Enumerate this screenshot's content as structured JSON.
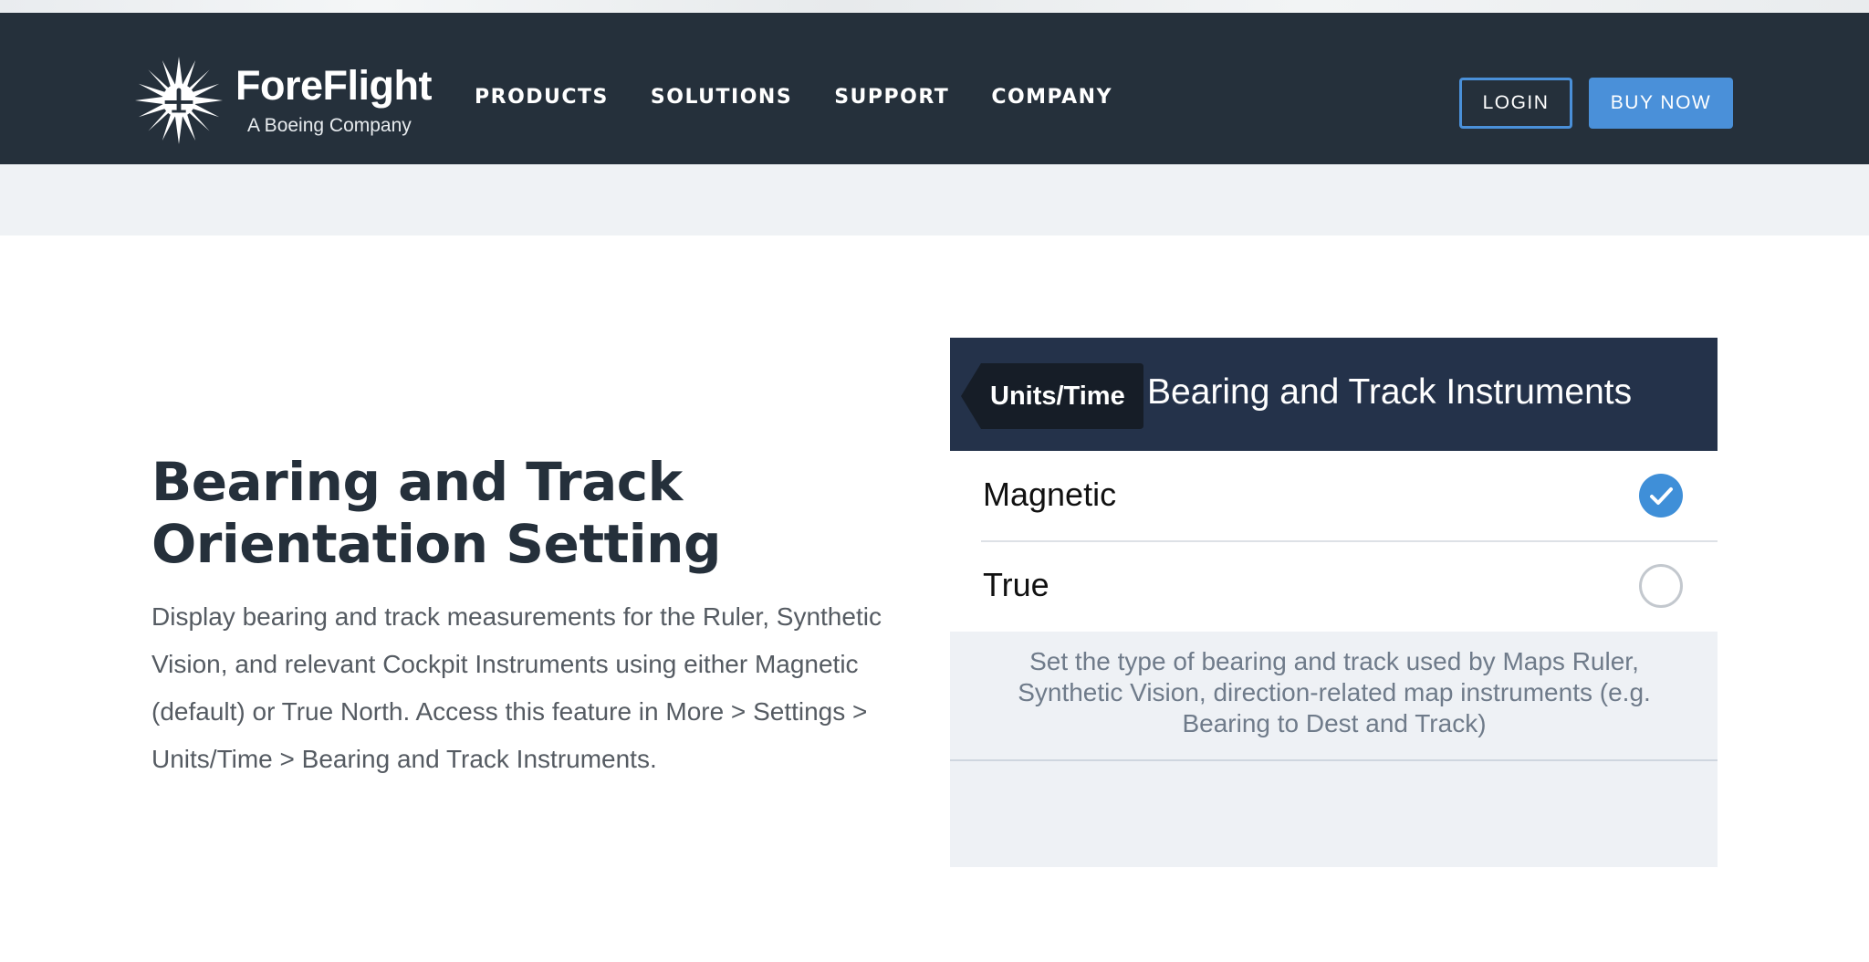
{
  "brand": {
    "name": "ForeFlight",
    "subtitle": "A Boeing Company"
  },
  "nav": {
    "links": [
      "PRODUCTS",
      "SOLUTIONS",
      "SUPPORT",
      "COMPANY"
    ],
    "login_label": "LOGIN",
    "buy_label": "BUY NOW"
  },
  "feature": {
    "title": "Bearing and Track Orientation Setting",
    "body": "Display bearing and track measurements for the Ruler, Synthetic Vision, and relevant Cockpit Instruments using either Magnetic (default) or True North. Access this feature in More > Settings > Units/Time > Bearing and Track Instruments."
  },
  "screenshot": {
    "back_label": "Units/Time",
    "title": "Bearing and Track Instruments",
    "options": [
      {
        "label": "Magnetic",
        "selected": true
      },
      {
        "label": "True",
        "selected": false
      }
    ],
    "footer_text": "Set the type of bearing and track used by Maps Ruler, Synthetic Vision, direction-related map instruments (e.g. Bearing to Dest and Track)"
  },
  "icons": {
    "logo": "sun-airplane-logo-icon",
    "selected": "checkmark-circle-icon",
    "unselected": "empty-circle-icon",
    "back": "back-arrow-icon"
  },
  "colors": {
    "navbar": "#25303b",
    "accent": "#4a90d9",
    "subbar": "#eff2f5",
    "screenshot_header": "#24324a",
    "title_text": "#25303b",
    "body_text": "#555b62"
  }
}
